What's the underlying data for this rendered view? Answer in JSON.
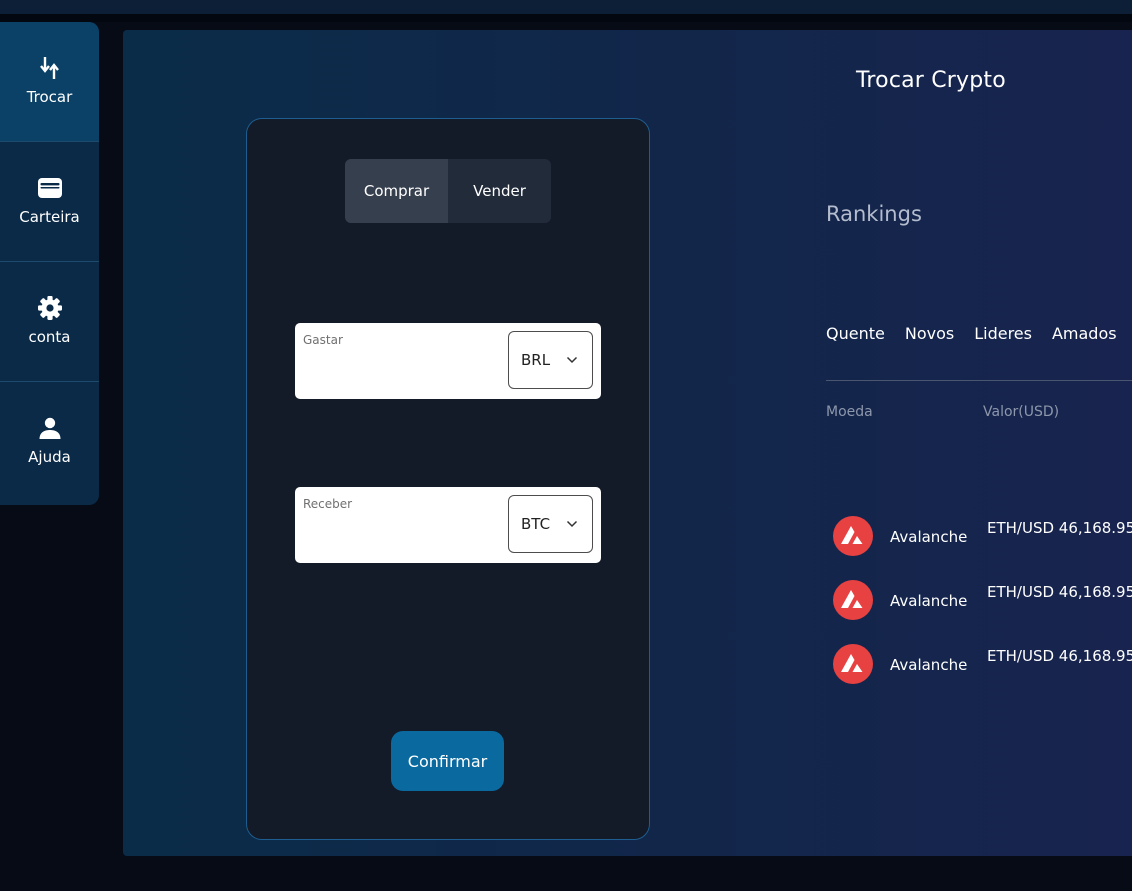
{
  "sidebar": {
    "items": [
      {
        "label": "Trocar",
        "icon": "swap-arrows-icon",
        "active": true
      },
      {
        "label": "Carteira",
        "icon": "wallet-icon",
        "active": false
      },
      {
        "label": "conta",
        "icon": "gear-icon",
        "active": false
      },
      {
        "label": "Ajuda",
        "icon": "person-icon",
        "active": false
      }
    ]
  },
  "page": {
    "title": "Trocar Crypto"
  },
  "trade": {
    "tabs": [
      {
        "label": "Comprar",
        "active": true
      },
      {
        "label": "Vender",
        "active": false
      }
    ],
    "spend": {
      "label": "Gastar",
      "currency": "BRL"
    },
    "receive": {
      "label": "Receber",
      "currency": "BTC"
    },
    "confirm_label": "Confirmar"
  },
  "rankings": {
    "title": "Rankings",
    "tabs": [
      "Quente",
      "Novos",
      "Lideres",
      "Amados"
    ],
    "columns": [
      "Moeda",
      "Valor(USD)"
    ],
    "rows": [
      {
        "name": "Avalanche",
        "pair": "ETH/USD 46,168.95",
        "icon": "avalanche-icon"
      },
      {
        "name": "Avalanche",
        "pair": "ETH/USD 46,168.95",
        "icon": "avalanche-icon"
      },
      {
        "name": "Avalanche",
        "pair": "ETH/USD 46,168.95",
        "icon": "avalanche-icon"
      }
    ]
  },
  "colors": {
    "sidebar": "#0a2a48",
    "sidebar_active": "#0b4166",
    "card": "#131a28",
    "accent": "#0a6aa0",
    "avalanche": "#e84142"
  }
}
